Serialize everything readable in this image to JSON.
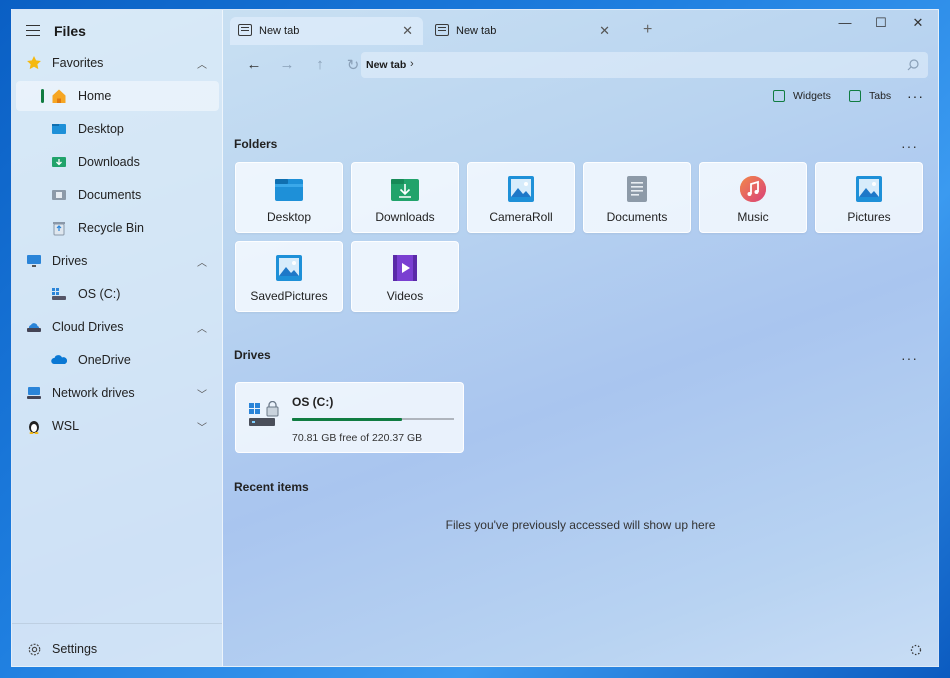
{
  "app": {
    "title": "Files"
  },
  "sidebar": {
    "items": [
      {
        "label": "Favorites",
        "icon": "star-icon",
        "chevron": "^"
      },
      {
        "label": "Home",
        "icon": "home-icon"
      },
      {
        "label": "Desktop",
        "icon": "desktop-folder-icon"
      },
      {
        "label": "Downloads",
        "icon": "downloads-folder-icon"
      },
      {
        "label": "Documents",
        "icon": "documents-folder-icon"
      },
      {
        "label": "Recycle Bin",
        "icon": "recycle-bin-icon"
      },
      {
        "label": "Drives",
        "icon": "monitor-icon",
        "chevron": "^"
      },
      {
        "label": "OS (C:)",
        "icon": "drive-icon"
      },
      {
        "label": "Cloud Drives",
        "icon": "cloud-drive-icon",
        "chevron": "^"
      },
      {
        "label": "OneDrive",
        "icon": "onedrive-icon"
      },
      {
        "label": "Network drives",
        "icon": "network-icon",
        "chevron": "v"
      },
      {
        "label": "WSL",
        "icon": "linux-penguin-icon",
        "chevron": "v"
      }
    ],
    "settings_label": "Settings"
  },
  "tabs": [
    {
      "label": "New tab",
      "active": true
    },
    {
      "label": "New tab",
      "active": false
    }
  ],
  "tab_close_glyph": "✕",
  "new_tab_glyph": "+",
  "window_controls": {
    "minimize": "—",
    "maximize": "☐",
    "close": "✕"
  },
  "nav": {
    "back": "←",
    "forward": "→",
    "up": "↑",
    "refresh": "↻",
    "breadcrumb": "New tab",
    "breadcrumb_sep": "›"
  },
  "toolbar": {
    "widgets_label": "Widgets",
    "tabs_label": "Tabs",
    "more": "···"
  },
  "folders": {
    "title": "Folders",
    "more": "···",
    "items": [
      {
        "label": "Desktop",
        "icon": "desktop-folder-icon"
      },
      {
        "label": "Downloads",
        "icon": "downloads-folder-icon"
      },
      {
        "label": "CameraRoll",
        "icon": "pictures-icon"
      },
      {
        "label": "Documents",
        "icon": "documents-icon"
      },
      {
        "label": "Music",
        "icon": "music-icon"
      },
      {
        "label": "Pictures",
        "icon": "pictures-icon"
      },
      {
        "label": "SavedPictures",
        "icon": "pictures-icon"
      },
      {
        "label": "Videos",
        "icon": "videos-icon"
      }
    ]
  },
  "drives": {
    "title": "Drives",
    "more": "···",
    "items": [
      {
        "name": "OS (C:)",
        "free_text": "70.81 GB free of 220.37 GB",
        "used_fraction": 0.679
      }
    ]
  },
  "recent": {
    "title": "Recent items",
    "empty_text": "Files you've previously accessed will show up here"
  },
  "colors": {
    "accent": "#107c41",
    "folder_blue": "#1e90d8",
    "download_green": "#21a36b",
    "video_purple": "#7a3fd1",
    "music_orange": "#ef6b3a"
  }
}
